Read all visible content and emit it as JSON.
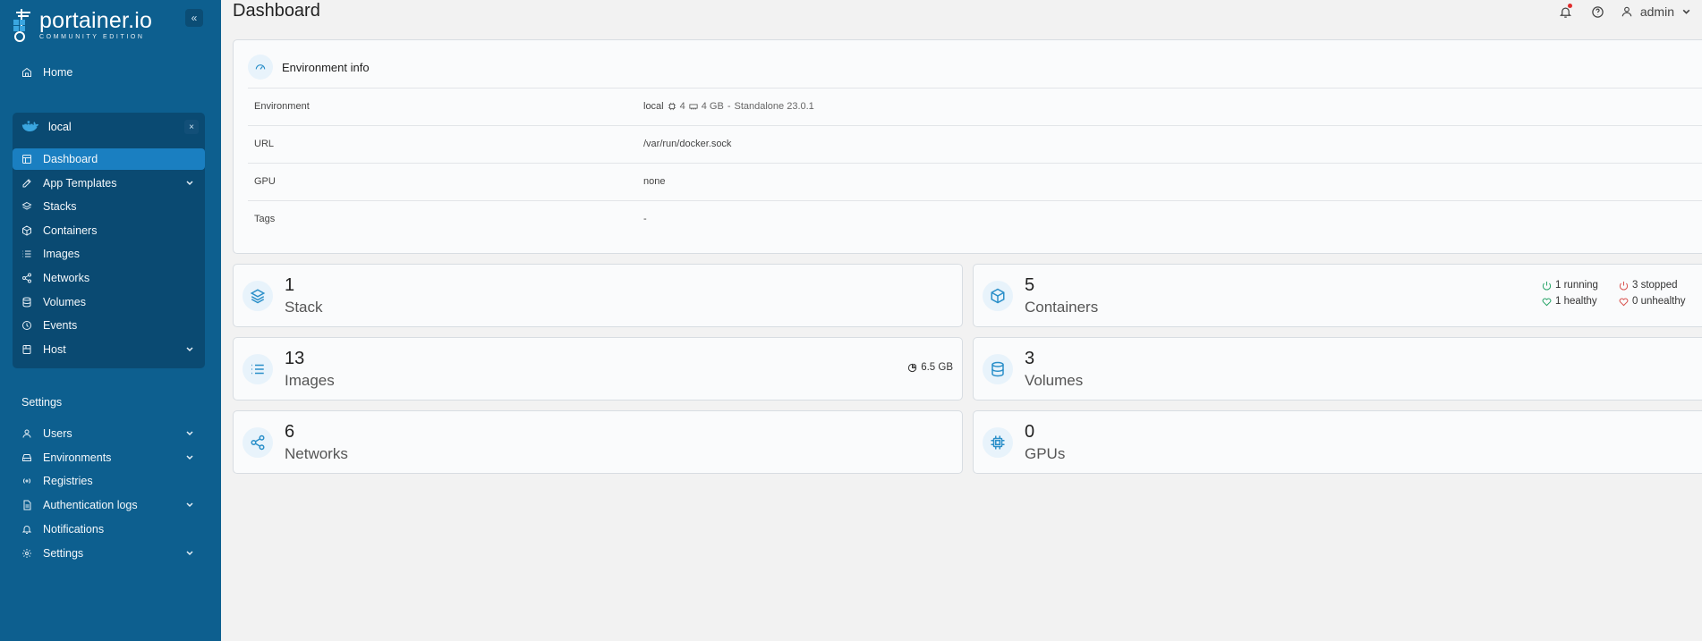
{
  "brand": {
    "name": "portainer.io",
    "edition": "COMMUNITY EDITION",
    "collapse_glyph": "«"
  },
  "sidebar": {
    "home_label": "Home",
    "environment": {
      "name": "local",
      "close_glyph": "×",
      "items": [
        {
          "label": "Dashboard",
          "icon": "dashboard-icon",
          "active": true
        },
        {
          "label": "App Templates",
          "icon": "edit-icon",
          "expandable": true
        },
        {
          "label": "Stacks",
          "icon": "layers-icon"
        },
        {
          "label": "Containers",
          "icon": "box-icon"
        },
        {
          "label": "Images",
          "icon": "list-icon"
        },
        {
          "label": "Networks",
          "icon": "share-icon"
        },
        {
          "label": "Volumes",
          "icon": "database-icon"
        },
        {
          "label": "Events",
          "icon": "clock-icon"
        },
        {
          "label": "Host",
          "icon": "server-icon",
          "expandable": true
        }
      ]
    },
    "settings_section": "Settings",
    "settings_items": [
      {
        "label": "Users",
        "icon": "user-icon",
        "expandable": true
      },
      {
        "label": "Environments",
        "icon": "hdd-icon",
        "expandable": true
      },
      {
        "label": "Registries",
        "icon": "radio-icon"
      },
      {
        "label": "Authentication logs",
        "icon": "file-icon",
        "expandable": true
      },
      {
        "label": "Notifications",
        "icon": "bell-icon"
      },
      {
        "label": "Settings",
        "icon": "gear-icon",
        "expandable": true
      }
    ]
  },
  "header": {
    "title": "Dashboard",
    "user": "admin"
  },
  "env_info": {
    "title": "Environment info",
    "rows": {
      "environment": {
        "key": "Environment",
        "name": "local",
        "cpu": "4",
        "memory": "4 GB",
        "separator": "-",
        "engine": "Standalone 23.0.1"
      },
      "url": {
        "key": "URL",
        "value": "/var/run/docker.sock"
      },
      "gpu": {
        "key": "GPU",
        "value": "none"
      },
      "tags": {
        "key": "Tags",
        "value": "-"
      }
    }
  },
  "stats": {
    "stack": {
      "count": "1",
      "label": "Stack"
    },
    "containers": {
      "count": "5",
      "label": "Containers",
      "running": "1 running",
      "stopped": "3 stopped",
      "healthy": "1 healthy",
      "unhealthy": "0 unhealthy"
    },
    "images": {
      "count": "13",
      "label": "Images",
      "size": "6.5 GB"
    },
    "volumes": {
      "count": "3",
      "label": "Volumes"
    },
    "networks": {
      "count": "6",
      "label": "Networks"
    },
    "gpus": {
      "count": "0",
      "label": "GPUs"
    }
  },
  "colors": {
    "sidebar": "#0d5f8f",
    "active": "#1a7fc1",
    "accent": "#2a8fc9",
    "running": "#2aa56a",
    "stopped": "#d9534f"
  }
}
